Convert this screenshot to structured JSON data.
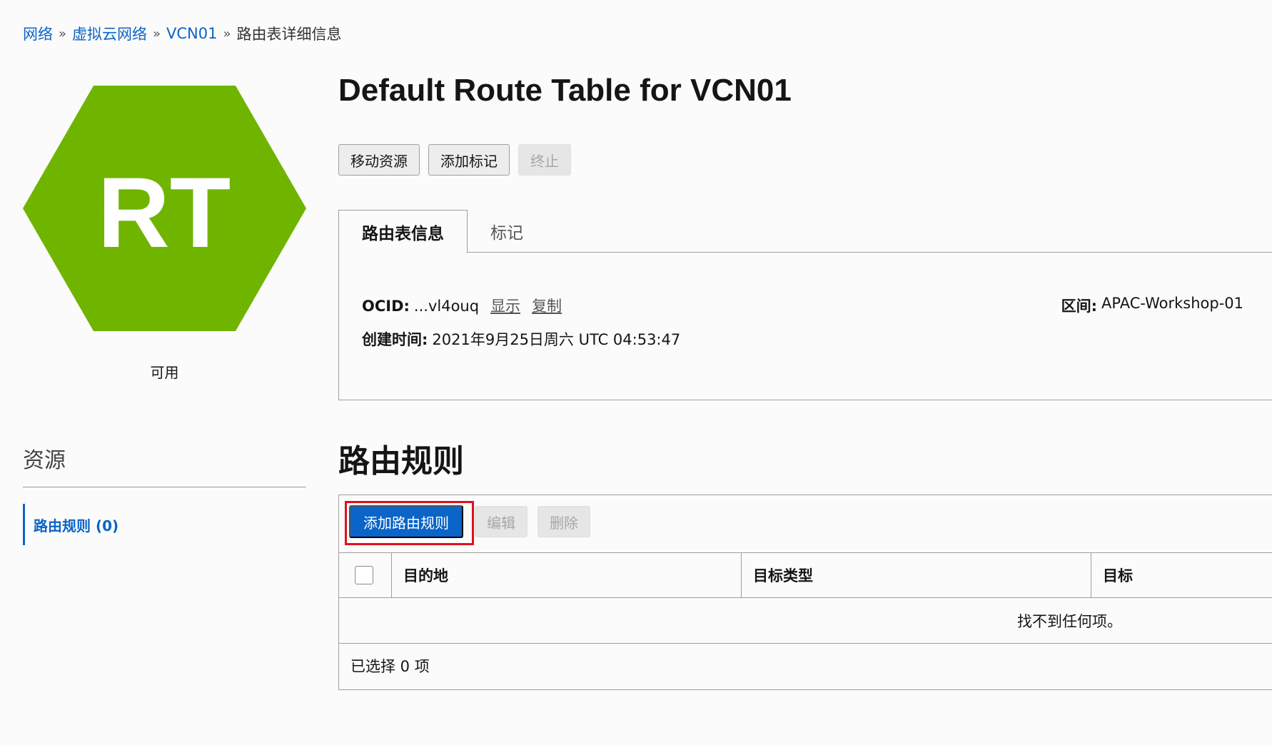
{
  "breadcrumb": {
    "items": [
      "网络",
      "虚拟云网络",
      "VCN01"
    ],
    "separator": "»",
    "current": "路由表详细信息"
  },
  "resource_icon": {
    "letters": "RT",
    "color": "#6fb500",
    "status": "可用"
  },
  "title": "Default Route Table for VCN01",
  "actions": {
    "move": "移动资源",
    "add_tag": "添加标记",
    "terminate": "终止"
  },
  "tabs": [
    {
      "label": "路由表信息",
      "active": true
    },
    {
      "label": "标记",
      "active": false
    }
  ],
  "info": {
    "ocid_label": "OCID:",
    "ocid_value": "...vl4ouq",
    "show": "显示",
    "copy": "复制",
    "created_label": "创建时间:",
    "created_value": "2021年9月25日周六 UTC 04:53:47",
    "compartment_label": "区间:",
    "compartment_value": "APAC-Workshop-01"
  },
  "resources": {
    "title": "资源",
    "items": [
      {
        "label": "路由规则 (0)",
        "active": true
      }
    ]
  },
  "route_rules": {
    "title": "路由规则",
    "add_button": "添加路由规则",
    "edit_button": "编辑",
    "delete_button": "删除",
    "columns": [
      "目的地",
      "目标类型",
      "目标"
    ],
    "empty_message": "找不到任何项。",
    "selected_text": "已选择 0 项"
  },
  "colors": {
    "link": "#0b64c7",
    "primary": "#0b64c7",
    "highlight": "#e0101b"
  }
}
